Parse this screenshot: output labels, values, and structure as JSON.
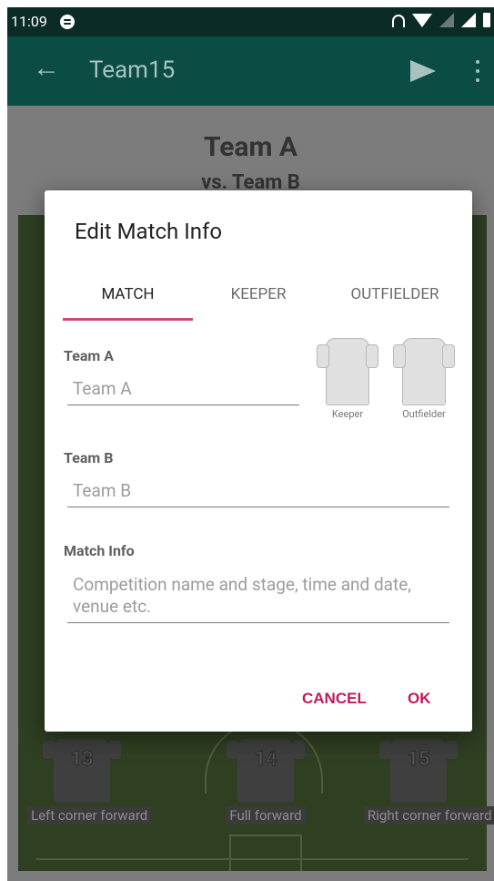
{
  "status_bar": {
    "time": "11:09"
  },
  "app_bar": {
    "title": "Team15"
  },
  "background": {
    "team_a": "Team A",
    "vs_line": "vs. Team B",
    "players": [
      {
        "number": "13",
        "position": "Left corner forward"
      },
      {
        "number": "14",
        "position": "Full forward"
      },
      {
        "number": "15",
        "position": "Right corner forward"
      }
    ]
  },
  "dialog": {
    "title": "Edit Match Info",
    "tabs": [
      "MATCH",
      "KEEPER",
      "OUTFIELDER"
    ],
    "team_a": {
      "label": "Team A",
      "placeholder": "Team A",
      "value": ""
    },
    "team_b": {
      "label": "Team B",
      "placeholder": "Team B",
      "value": ""
    },
    "match_info": {
      "label": "Match Info",
      "placeholder": "Competition name and stage, time and date, venue etc.",
      "value": ""
    },
    "jerseys": {
      "keeper": "Keeper",
      "outfielder": "Outfielder"
    },
    "cancel_label": "CANCEL",
    "ok_label": "OK"
  },
  "colors": {
    "status_bar": "#0b2b27",
    "app_bar": "#0b4c44",
    "accent": "#c2185b",
    "tab_indicator": "#d0447a",
    "scrim": "#7c7c7c"
  },
  "icons": [
    "back-arrow-icon",
    "send-icon",
    "more-vert-icon",
    "spotify-icon",
    "headphones-icon",
    "wifi-icon",
    "no-signal-icon",
    "signal-icon",
    "battery-icon",
    "shirt-icon"
  ]
}
